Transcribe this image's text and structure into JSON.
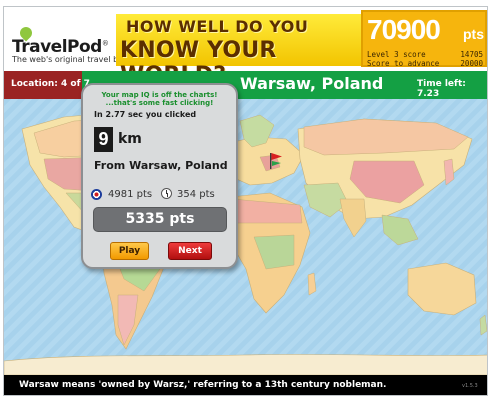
{
  "header": {
    "logo_brand": "TravelPod",
    "logo_mark": "®",
    "logo_tagline": "The web's original travel blog.",
    "banner_line1": "HOW WELL DO YOU",
    "banner_line2": "KNOW YOUR WORLD?",
    "score": "70900",
    "score_unit": "pts",
    "level_label": "Level 3 score",
    "level_value": "14705",
    "advance_label": "Score to advance",
    "advance_value": "20000"
  },
  "status": {
    "location": "Location: 4 of 7",
    "city": "Warsaw, Poland",
    "time_left": "Time left: 7.23"
  },
  "popup": {
    "iq_line1": "Your map IQ is off the charts!",
    "iq_line2": "...that's some fast clicking!",
    "clicked": "In 2.77 sec you clicked",
    "distance": "9",
    "distance_unit": "km",
    "from": "From Warsaw, Poland",
    "distance_points": "4981 pts",
    "time_points": "354 pts",
    "total": "5335 pts",
    "play_label": "Play",
    "next_label": "Next"
  },
  "footer": {
    "fact": "Warsaw means 'owned by Warsz,' referring to a 13th century nobleman.",
    "version": "v1.5.3"
  },
  "colors": {
    "status_red": "#9a2323",
    "status_green": "#14a044",
    "score_orange": "#f6b50d",
    "ocean": "#a9d3ec"
  },
  "icons": [
    "travelpod-logo-icon",
    "banner-flag-icon",
    "target-icon",
    "clock-icon",
    "map-flag-marker-icon"
  ]
}
